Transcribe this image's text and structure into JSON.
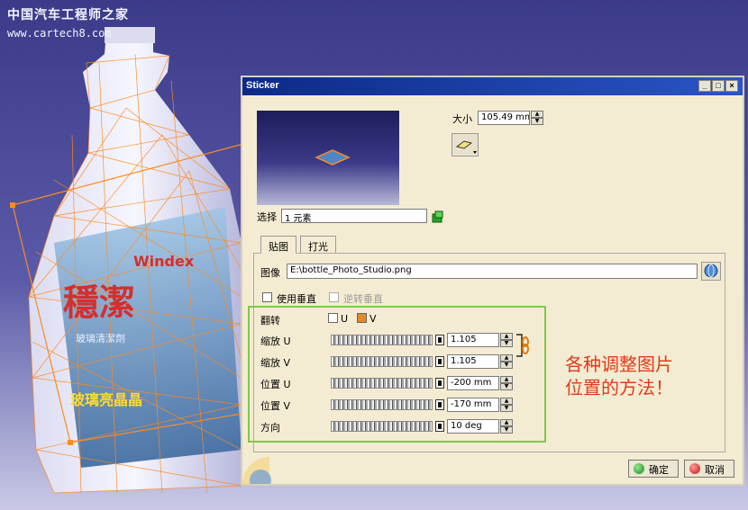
{
  "watermark": {
    "line1": "中国汽车工程师之家",
    "line2": "www.cartech8.com"
  },
  "dialog": {
    "title": "Sticker",
    "size_label": "大小",
    "size_value": "105.49 mm",
    "select_label": "选择",
    "select_value": "1 元素",
    "tabs": [
      "贴图",
      "打光"
    ],
    "image_label": "图像",
    "image_path": "E:\\bottle_Photo_Studio.png",
    "use_normal_label": "使用垂直",
    "reverse_normal_label": "逆转垂直",
    "flip_label": "翻转",
    "flip_u": "U",
    "flip_v": "V",
    "flip_u_checked": false,
    "flip_v_checked": true,
    "rows": [
      {
        "label": "缩放 U",
        "value": "1.105"
      },
      {
        "label": "缩放 V",
        "value": "1.105"
      },
      {
        "label": "位置 U",
        "value": "-200 mm"
      },
      {
        "label": "位置 V",
        "value": "-170 mm"
      },
      {
        "label": "方向",
        "value": "10 deg"
      }
    ],
    "ok_label": "确定",
    "cancel_label": "取消"
  },
  "annotation": {
    "line1": "各种调整图片",
    "line2": "位置的方法！"
  },
  "colors": {
    "title_bar": "#0c2a88",
    "highlight_box": "#7cc84a",
    "annotation": "#e23a1a",
    "mesh": "#ff8a1e"
  }
}
